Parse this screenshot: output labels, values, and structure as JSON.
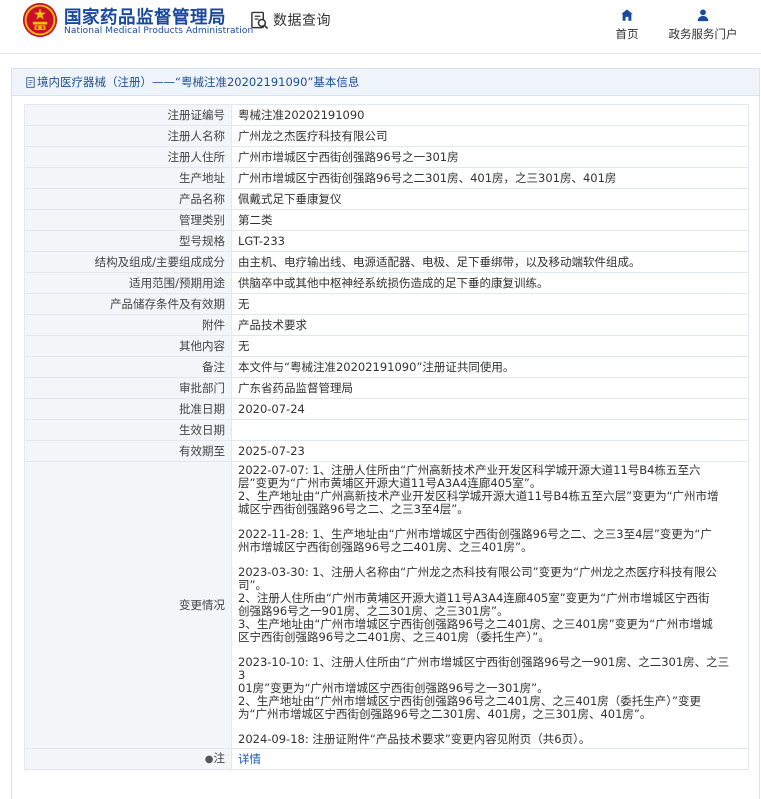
{
  "header": {
    "title_cn": "国家药品监督管理局",
    "title_en": "National Medical Products Administration",
    "data_query": "数据查询",
    "nav": [
      {
        "label": "首页",
        "icon": "home-icon"
      },
      {
        "label": "政务服务门户",
        "icon": "user-icon"
      }
    ]
  },
  "breadcrumb": "境内医疗器械（注册）——“粤械注准20202191090”基本信息",
  "rows": [
    {
      "label": "注册证编号",
      "value": "粤械注准20202191090"
    },
    {
      "label": "注册人名称",
      "value": "广州龙之杰医疗科技有限公司"
    },
    {
      "label": "注册人住所",
      "value": "广州市增城区宁西街创强路96号之一301房"
    },
    {
      "label": "生产地址",
      "value": "广州市增城区宁西街创强路96号之二301房、401房，之三301房、401房"
    },
    {
      "label": "产品名称",
      "value": "佩戴式足下垂康复仪"
    },
    {
      "label": "管理类别",
      "value": "第二类"
    },
    {
      "label": "型号规格",
      "value": "LGT-233"
    },
    {
      "label": "结构及组成/主要组成成分",
      "value": "由主机、电疗输出线、电源适配器、电极、足下垂绑带，以及移动端软件组成。"
    },
    {
      "label": "适用范围/预期用途",
      "value": "供脑卒中或其他中枢神经系统损伤造成的足下垂的康复训练。"
    },
    {
      "label": "产品储存条件及有效期",
      "value": "无"
    },
    {
      "label": "附件",
      "value": "产品技术要求"
    },
    {
      "label": "其他内容",
      "value": "无"
    },
    {
      "label": "备注",
      "value": "本文件与“粤械注准20202191090”注册证共同使用。"
    },
    {
      "label": "审批部门",
      "value": "广东省药品监督管理局"
    },
    {
      "label": "批准日期",
      "value": "2020-07-24"
    },
    {
      "label": "生效日期",
      "value": ""
    },
    {
      "label": "有效期至",
      "value": "2025-07-23"
    }
  ],
  "changes": {
    "label": "变更情况",
    "blocks": [
      [
        "2022-07-07: 1、注册人住所由“广州高新技术产业开发区科学城开源大道11号B4栋五至六",
        "层”变更为“广州市黄埔区开源大道11号A3A4连廊405室”。",
        "2、生产地址由“广州高新技术产业开发区科学城开源大道11号B4栋五至六层”变更为“广州市增",
        "城区宁西街创强路96号之二、之三3至4层”。"
      ],
      [
        "2022-11-28: 1、生产地址由“广州市增城区宁西街创强路96号之二、之三3至4层”变更为“广",
        "州市增城区宁西街创强路96号之二401房、之三401房”。"
      ],
      [
        "2023-03-30: 1、注册人名称由“广州龙之杰科技有限公司”变更为“广州龙之杰医疗科技有限公",
        "司”。",
        "2、注册人住所由“广州市黄埔区开源大道11号A3A4连廊405室”变更为“广州市增城区宁西街",
        "创强路96号之一901房、之二301房、之三301房”。",
        "3、生产地址由“广州市增城区宁西街创强路96号之二401房、之三401房”变更为“广州市增城",
        "区宁西街创强路96号之二401房、之三401房（委托生产）”。"
      ],
      [
        "2023-10-10: 1、注册人住所由“广州市增城区宁西街创强路96号之一901房、之二301房、之三3",
        "01房”变更为“广州市增城区宁西街创强路96号之一301房”。",
        "2、生产地址由“广州市增城区宁西街创强路96号之二401房、之三401房（委托生产）”变更",
        "为“广州市增城区宁西街创强路96号之二301房、401房，之三301房、401房”。"
      ],
      [
        "2024-09-18: 注册证附件“产品技术要求”变更内容见附页（共6页）。"
      ]
    ]
  },
  "note_row": {
    "glyph": "●",
    "label": "注",
    "link": "详情"
  },
  "colors": {
    "brand_blue": "#1a4a9f",
    "link_blue": "#1a55b5",
    "label_bg": "#f3f5f8",
    "crumb_bg": "#eef4fa"
  }
}
